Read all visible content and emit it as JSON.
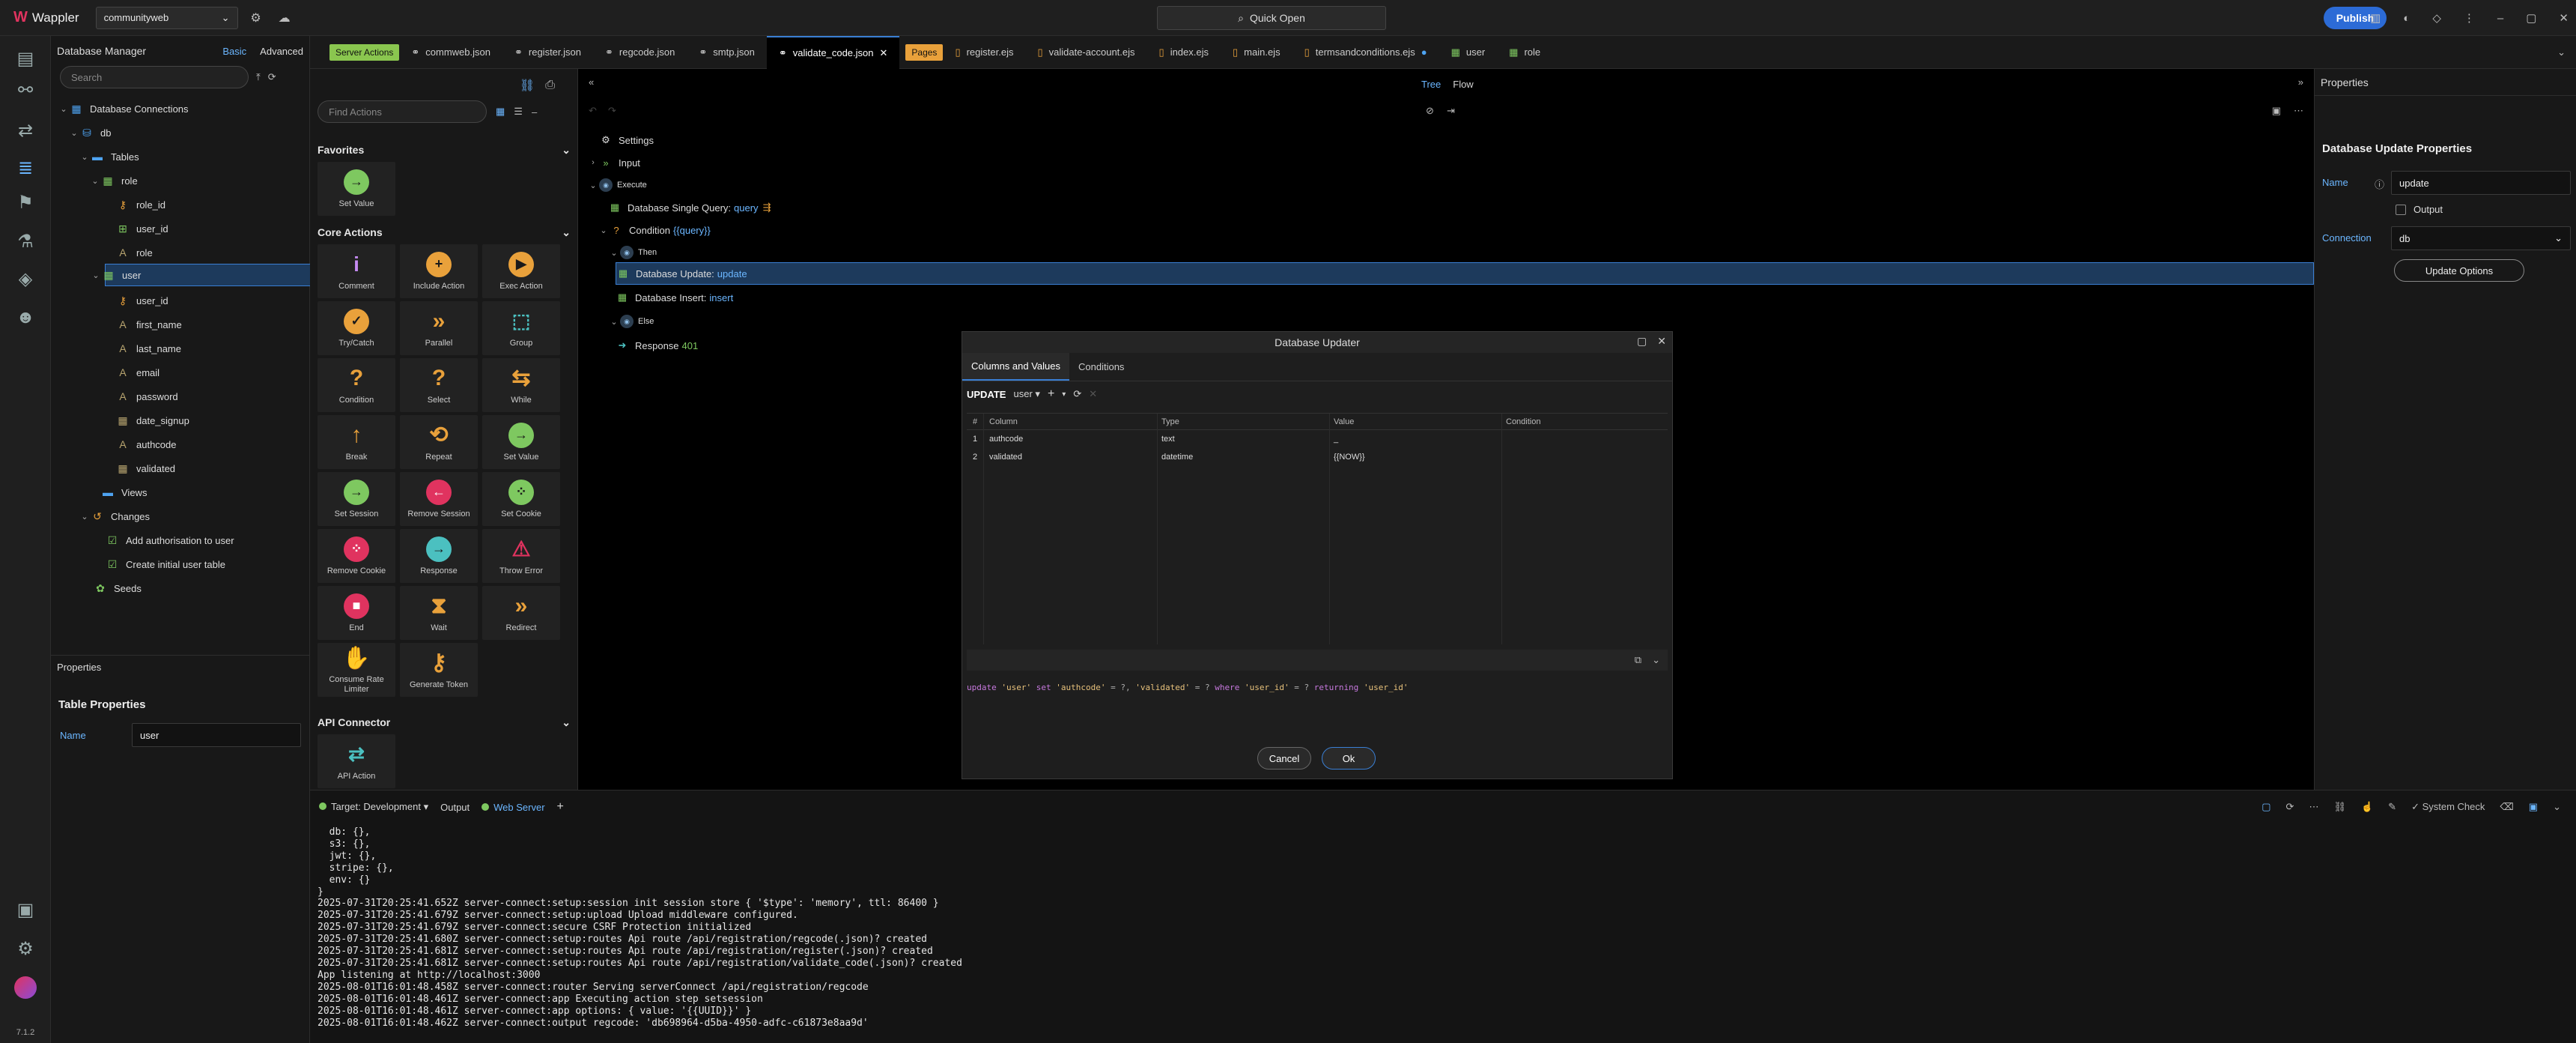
{
  "app": {
    "name": "Wappler",
    "project": "communityweb",
    "quick_open": "Quick Open",
    "publish": "Publish",
    "version": "7.1.2",
    "pro_badge": "Pro"
  },
  "tabs": {
    "server_actions_badge": "Server Actions",
    "pages_badge": "Pages",
    "server_files": [
      "commweb.json",
      "register.json",
      "regcode.json",
      "smtp.json",
      "validate_code.json"
    ],
    "active_file": "validate_code.json",
    "page_files": [
      "register.ejs",
      "validate-account.ejs",
      "index.ejs",
      "main.ejs",
      "termsandconditions.ejs"
    ],
    "table_tabs": [
      "user",
      "role"
    ]
  },
  "db_manager": {
    "title": "Database Manager",
    "mode_basic": "Basic",
    "mode_advanced": "Advanced",
    "search_placeholder": "Search",
    "tree": {
      "connections": "Database Connections",
      "db": "db",
      "tables": "Tables",
      "role": "role",
      "role_fields": [
        "role_id",
        "user_id",
        "role"
      ],
      "user": "user",
      "user_fields": [
        "user_id",
        "first_name",
        "last_name",
        "email",
        "password",
        "date_signup",
        "authcode",
        "validated"
      ],
      "views": "Views",
      "changes": "Changes",
      "change_items": [
        "Add authorisation to user",
        "Create initial user table"
      ],
      "seeds": "Seeds"
    },
    "properties": {
      "header": "Properties",
      "title": "Table Properties",
      "name_label": "Name",
      "name_value": "user"
    }
  },
  "actions": {
    "find_placeholder": "Find Actions",
    "favorites": "Favorites",
    "favorite_items": [
      "Set Value"
    ],
    "core": "Core Actions",
    "core_items": [
      "Comment",
      "Include Action",
      "Exec Action",
      "Try/Catch",
      "Parallel",
      "Group",
      "Condition",
      "Select",
      "While",
      "Break",
      "Repeat",
      "Set Value",
      "Set Session",
      "Remove Session",
      "Set Cookie",
      "Remove Cookie",
      "Response",
      "Throw Error",
      "End",
      "Wait",
      "Redirect",
      "Consume Rate Limiter",
      "Generate Token"
    ],
    "api": "API Connector",
    "api_items": [
      "API Action"
    ]
  },
  "flow": {
    "view_tree": "Tree",
    "view_flow": "Flow",
    "settings": "Settings",
    "input": "Input",
    "execute": "Execute",
    "single_query": "Database Single Query:",
    "single_query_name": "query",
    "condition": "Condition",
    "condition_expr": "{{query}}",
    "then": "Then",
    "update": "Database Update:",
    "update_name": "update",
    "insert": "Database Insert:",
    "insert_name": "insert",
    "else": "Else",
    "response": "Response",
    "response_code": "401"
  },
  "properties_panel": {
    "header": "Properties",
    "title": "Database Update Properties",
    "name_label": "Name",
    "name_value": "update",
    "output_label": "Output",
    "connection_label": "Connection",
    "connection_value": "db",
    "update_options": "Update Options"
  },
  "modal": {
    "title": "Database Updater",
    "tab_columns": "Columns and Values",
    "tab_conditions": "Conditions",
    "update_label": "UPDATE",
    "table": "user",
    "headers": {
      "num": "#",
      "column": "Column",
      "type": "Type",
      "value": "Value",
      "condition": "Condition"
    },
    "rows": [
      {
        "num": "1",
        "column": "authcode",
        "type": "text",
        "value": "_",
        "condition": ""
      },
      {
        "num": "2",
        "column": "validated",
        "type": "datetime",
        "value": "{{NOW}}",
        "condition": ""
      }
    ],
    "sql": {
      "kw_update": "update",
      "t1": "'user'",
      "kw_set": "set",
      "t2": "'authcode'",
      "o1": "= ?,",
      "t3": "'validated'",
      "o2": "= ?",
      "kw_where": "where",
      "t4": "'user_id'",
      "o3": "= ?",
      "kw_returning": "returning",
      "t5": "'user_id'"
    },
    "cancel": "Cancel",
    "ok": "Ok"
  },
  "bottom": {
    "target_label": "Target: Development",
    "output": "Output",
    "web_server": "Web Server",
    "system_check": "System Check",
    "console": [
      "  db: {},",
      "  s3: {},",
      "  jwt: {},",
      "  stripe: {},",
      "  env: {}",
      "}",
      "2025-07-31T20:25:41.652Z server-connect:setup:session init session store { '$type': 'memory', ttl: 86400 }",
      "2025-07-31T20:25:41.679Z server-connect:setup:upload Upload middleware configured.",
      "2025-07-31T20:25:41.679Z server-connect:secure CSRF Protection initialized",
      "2025-07-31T20:25:41.680Z server-connect:setup:routes Api route /api/registration/regcode(.json)? created",
      "2025-07-31T20:25:41.681Z server-connect:setup:routes Api route /api/registration/register(.json)? created",
      "2025-07-31T20:25:41.681Z server-connect:setup:routes Api route /api/registration/validate_code(.json)? created",
      "App listening at http://localhost:3000",
      "2025-08-01T16:01:48.458Z server-connect:router Serving serverConnect /api/registration/regcode",
      "2025-08-01T16:01:48.461Z server-connect:app Executing action step setsession",
      "2025-08-01T16:01:48.461Z server-connect:app options: { value: '{{UUID}}' }",
      "2025-08-01T16:01:48.462Z server-connect:output regcode: 'db698964-d5ba-4950-adfc-c61873e8aa9d'"
    ]
  }
}
